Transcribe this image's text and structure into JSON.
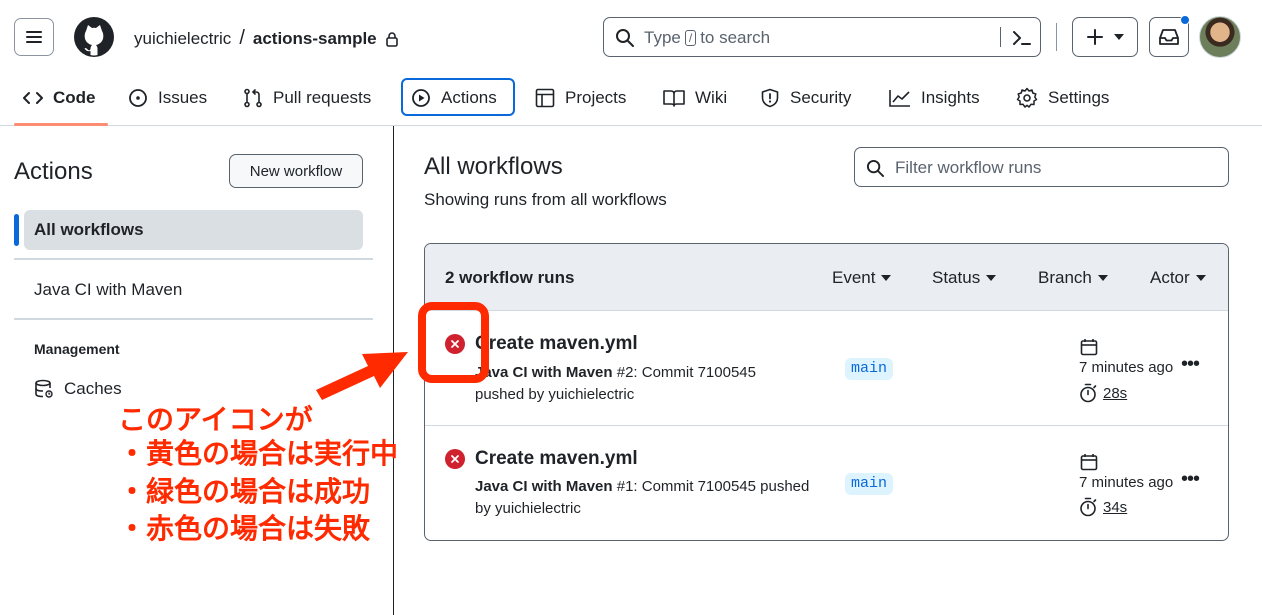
{
  "header": {
    "owner": "yuichielectric",
    "separator": "/",
    "repo": "actions-sample",
    "search_placeholder_pre": "Type",
    "search_key": "/",
    "search_placeholder_post": "to search"
  },
  "repo_nav": {
    "tabs": [
      {
        "label": "Code",
        "icon": "code-icon"
      },
      {
        "label": "Issues",
        "icon": "issue-opened-icon"
      },
      {
        "label": "Pull requests",
        "icon": "git-pull-request-icon"
      },
      {
        "label": "Actions",
        "icon": "play-icon"
      },
      {
        "label": "Projects",
        "icon": "table-icon"
      },
      {
        "label": "Wiki",
        "icon": "book-icon"
      },
      {
        "label": "Security",
        "icon": "shield-icon"
      },
      {
        "label": "Insights",
        "icon": "graph-icon"
      },
      {
        "label": "Settings",
        "icon": "gear-icon"
      }
    ],
    "selected": "Actions"
  },
  "sidebar": {
    "title": "Actions",
    "new_workflow": "New workflow",
    "all_workflows": "All workflows",
    "workflows": [
      "Java CI with Maven"
    ],
    "management_heading": "Management",
    "caches": "Caches"
  },
  "main": {
    "title": "All workflows",
    "subtitle": "Showing runs from all workflows",
    "filter_placeholder": "Filter workflow runs",
    "runs_count": "2 workflow runs",
    "filters": [
      "Event",
      "Status",
      "Branch",
      "Actor"
    ],
    "runs": [
      {
        "title": "Create maven.yml",
        "workflow": "Java CI with Maven",
        "detail": " #2: Commit 7100545",
        "detail2": "pushed by yuichielectric",
        "branch": "main",
        "time": "7 minutes ago",
        "duration": "28s",
        "status": "failure"
      },
      {
        "title": "Create maven.yml",
        "workflow": "Java CI with Maven",
        "detail": " #1: Commit 7100545 pushed",
        "detail2": "by yuichielectric",
        "branch": "main",
        "time": "7 minutes ago",
        "duration": "34s",
        "status": "failure"
      }
    ]
  },
  "annotation": {
    "lines": [
      "このアイコンが",
      "・黄色の場合は実行中",
      "・緑色の場合は成功",
      "・赤色の場合は失敗"
    ],
    "color": "#ff2a00"
  },
  "colors": {
    "accent": "#0969da",
    "failure": "#cf222e",
    "tab_underline": "#fd8c73"
  }
}
